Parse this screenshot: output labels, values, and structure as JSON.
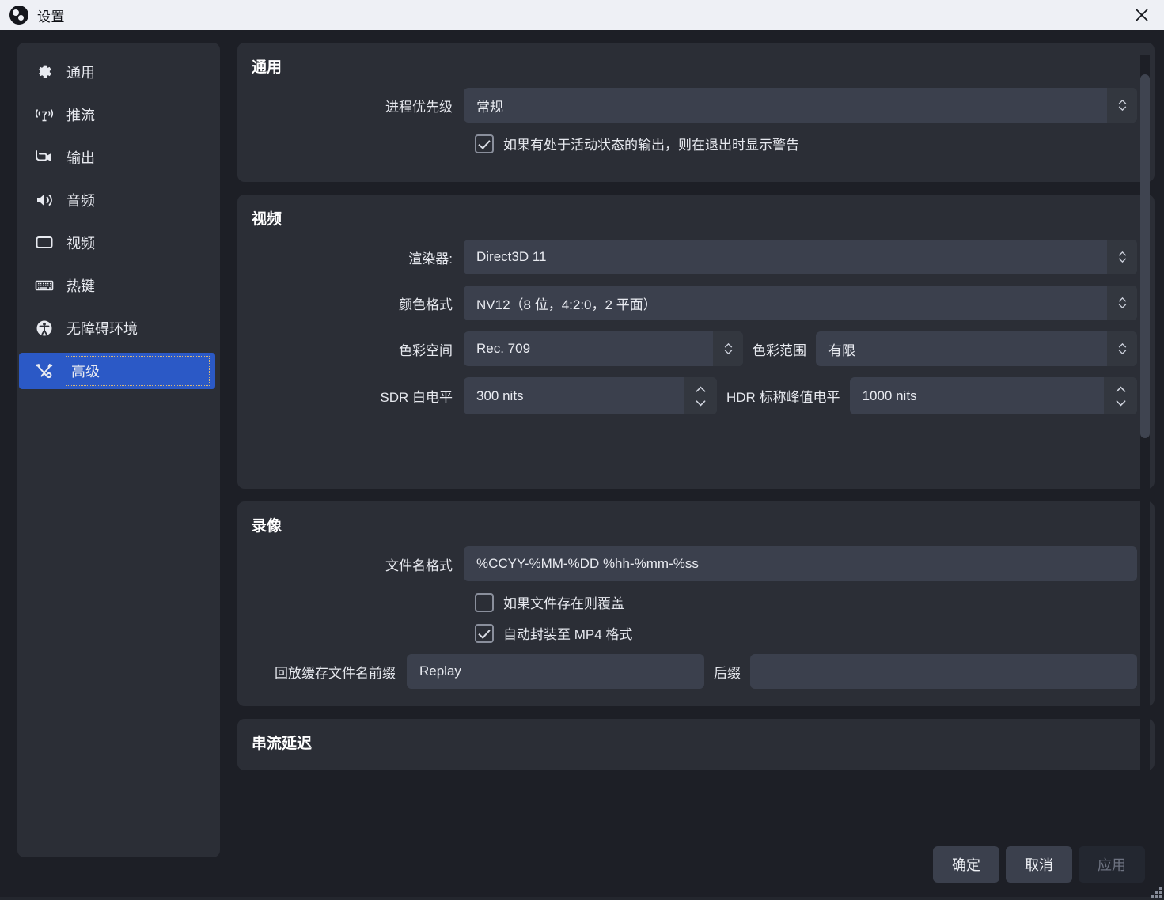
{
  "window": {
    "title": "设置",
    "logo_icon": "obs-logo-icon",
    "close_icon": "close-icon"
  },
  "sidebar": {
    "items": [
      {
        "label": "通用",
        "icon": "gear-icon",
        "selected": false
      },
      {
        "label": "推流",
        "icon": "broadcast-icon",
        "selected": false
      },
      {
        "label": "输出",
        "icon": "video-camera-icon",
        "selected": false
      },
      {
        "label": "音频",
        "icon": "speaker-icon",
        "selected": false
      },
      {
        "label": "视频",
        "icon": "monitor-icon",
        "selected": false
      },
      {
        "label": "热键",
        "icon": "keyboard-icon",
        "selected": false
      },
      {
        "label": "无障碍环境",
        "icon": "accessibility-icon",
        "selected": false
      },
      {
        "label": "高级",
        "icon": "tools-icon",
        "selected": true
      }
    ]
  },
  "sections": {
    "general": {
      "title": "通用",
      "process_priority_label": "进程优先级",
      "process_priority_value": "常规",
      "exit_warning_label": "如果有处于活动状态的输出，则在退出时显示警告",
      "exit_warning_checked": true
    },
    "video": {
      "title": "视频",
      "renderer_label": "渲染器:",
      "renderer_value": "Direct3D 11",
      "color_format_label": "颜色格式",
      "color_format_value": "NV12（8 位，4:2:0，2 平面）",
      "color_space_label": "色彩空间",
      "color_space_value": "Rec. 709",
      "color_range_label": "色彩范围",
      "color_range_value": "有限",
      "sdr_white_label": "SDR 白电平",
      "sdr_white_value": "300 nits",
      "hdr_peak_label": "HDR 标称峰值电平",
      "hdr_peak_value": "1000 nits"
    },
    "recording": {
      "title": "录像",
      "filename_format_label": "文件名格式",
      "filename_format_value": "%CCYY-%MM-%DD %hh-%mm-%ss",
      "overwrite_label": "如果文件存在则覆盖",
      "overwrite_checked": false,
      "automux_label": "自动封装至 MP4 格式",
      "automux_checked": true,
      "replay_prefix_label": "回放缓存文件名前缀",
      "replay_prefix_value": "Replay",
      "replay_suffix_label": "后缀",
      "replay_suffix_value": ""
    },
    "stream_delay": {
      "title": "串流延迟"
    }
  },
  "footer": {
    "ok_label": "确定",
    "cancel_label": "取消",
    "apply_label": "应用"
  },
  "colors": {
    "accent_selected": "#2b59c6",
    "panel_bg": "#2b2e36",
    "page_bg": "#1d1f26",
    "field_bg": "#3b404d",
    "titlebar_bg": "#eef0f5",
    "focus_outline": "#d8b878"
  }
}
